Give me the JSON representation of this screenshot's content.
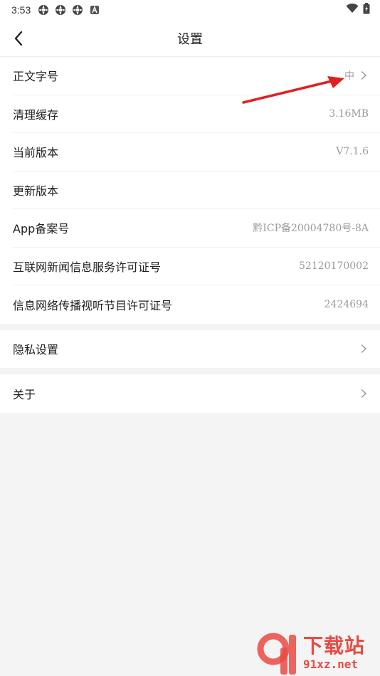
{
  "statusbar": {
    "time": "3:53",
    "icons": [
      "settings-icon",
      "settings-icon",
      "settings-icon",
      "a-icon"
    ],
    "right_icons": [
      "wifi-icon",
      "battery-icon"
    ]
  },
  "appbar": {
    "title": "设置",
    "back_icon": "chevron-left-icon"
  },
  "groups": [
    {
      "rows": [
        {
          "label": "正文字号",
          "value": "中",
          "chevron": true
        },
        {
          "label": "清理缓存",
          "value": "3.16MB",
          "chevron": false
        },
        {
          "label": "当前版本",
          "value": "V7.1.6",
          "chevron": false
        },
        {
          "label": "更新版本",
          "value": "",
          "chevron": false
        },
        {
          "label": "App备案号",
          "value": "黔ICP备20004780号-8A",
          "chevron": false
        },
        {
          "label": "互联网新闻信息服务许可证号",
          "value": "52120170002",
          "chevron": false
        },
        {
          "label": "信息网络传播视听节目许可证号",
          "value": "2424694",
          "chevron": false
        }
      ]
    },
    {
      "rows": [
        {
          "label": "隐私设置",
          "value": "",
          "chevron": true
        }
      ]
    },
    {
      "rows": [
        {
          "label": "关于",
          "value": "",
          "chevron": true
        }
      ]
    }
  ],
  "annotation": {
    "color": "#e02020"
  },
  "watermark": {
    "line1": "下载站",
    "line2": "91xz.net",
    "color": "#e94a43"
  }
}
